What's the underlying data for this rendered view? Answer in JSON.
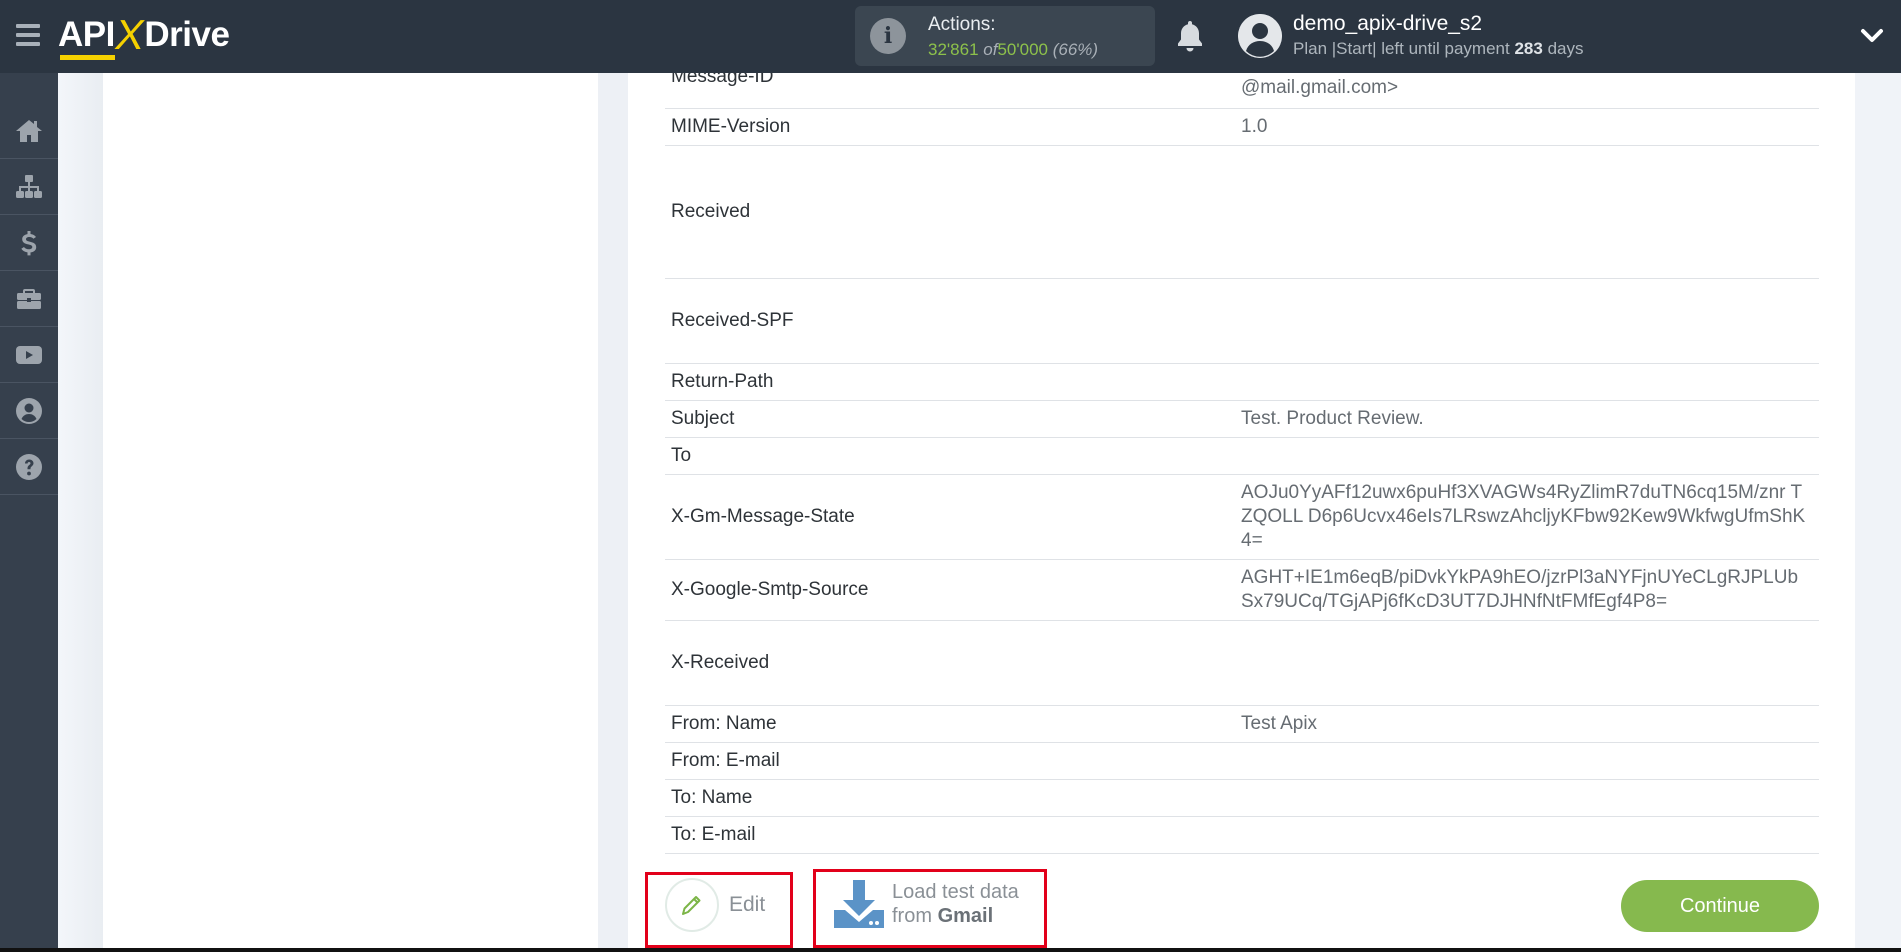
{
  "header": {
    "logo": {
      "part1": "API",
      "part2": "X",
      "part3": "Drive"
    },
    "actions": {
      "label": "Actions:",
      "used": "32'861",
      "of": "of",
      "total": "50'000",
      "percent": "(66%)"
    },
    "user": {
      "name": "demo_apix-drive_s2",
      "plan_prefix": "Plan |Start| left until payment",
      "days": "283",
      "days_suffix": "days"
    }
  },
  "sidebar": {
    "items": [
      {
        "name": "home",
        "icon": "home-icon"
      },
      {
        "name": "connections",
        "icon": "sitemap-icon"
      },
      {
        "name": "billing",
        "icon": "dollar-icon"
      },
      {
        "name": "tools",
        "icon": "briefcase-icon"
      },
      {
        "name": "videos",
        "icon": "youtube-icon"
      },
      {
        "name": "account",
        "icon": "user-circle-icon"
      },
      {
        "name": "help",
        "icon": "question-circle-icon"
      }
    ]
  },
  "table": {
    "rows": [
      {
        "key": "Message-ID",
        "value": "@mail.gmail.com>"
      },
      {
        "key": "MIME-Version",
        "value": "1.0"
      },
      {
        "key": "Received",
        "value": ""
      },
      {
        "key": "Received-SPF",
        "value": ""
      },
      {
        "key": "Return-Path",
        "value": ""
      },
      {
        "key": "Subject",
        "value": "Test. Product Review."
      },
      {
        "key": "To",
        "value": ""
      },
      {
        "key": "X-Gm-Message-State",
        "value": "AOJu0YyAFf12uwx6puHf3XVAGWs4RyZlimR7duTN6cq15M/znr TZQOLL D6p6Ucvx46eIs7LRswzAhcljyKFbw92Kew9WkfwgUfmShK4="
      },
      {
        "key": "X-Google-Smtp-Source",
        "value": "AGHT+IE1m6eqB/piDvkYkPA9hEO/jzrPl3aNYFjnUYeCLgRJPLUbSx79UCq/TGjAPj6fKcD3UT7DJHNfNtFMfEgf4P8="
      },
      {
        "key": "X-Received",
        "value": ""
      },
      {
        "key": "From: Name",
        "value": "Test Apix"
      },
      {
        "key": "From: E-mail",
        "value": ""
      },
      {
        "key": "To: Name",
        "value": ""
      },
      {
        "key": "To: E-mail",
        "value": ""
      }
    ]
  },
  "buttons": {
    "edit": "Edit",
    "load_line1": "Load test data",
    "load_from": "from",
    "load_source": "Gmail",
    "continue": "Continue"
  },
  "colors": {
    "header_bg": "#2b3541",
    "sidebar_bg": "#36404d",
    "accent_yellow": "#f5d100",
    "accent_green": "#86b94e",
    "highlight_red": "#e2001a",
    "download_blue": "#5b93c7"
  }
}
